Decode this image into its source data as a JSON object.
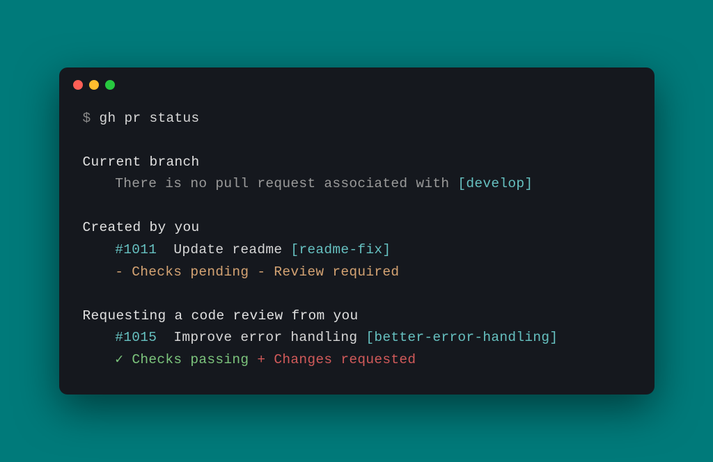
{
  "prompt": {
    "symbol": "$",
    "command": "gh pr status"
  },
  "sections": {
    "current_branch": {
      "header": "Current branch",
      "message": "There is no pull request associated with ",
      "branch": "[develop]"
    },
    "created_by_you": {
      "header": "Created by you",
      "pr_number": "#1011",
      "pr_title": "Update readme ",
      "branch": "[readme-fix]",
      "status_line": "- Checks pending - Review required"
    },
    "requesting_review": {
      "header": "Requesting a code review from you",
      "pr_number": "#1015",
      "pr_title": "Improve error handling ",
      "branch": "[better-error-handling]",
      "check_symbol": "✓",
      "check_text": " Checks passing ",
      "changes_text": "+ Changes requested"
    }
  }
}
